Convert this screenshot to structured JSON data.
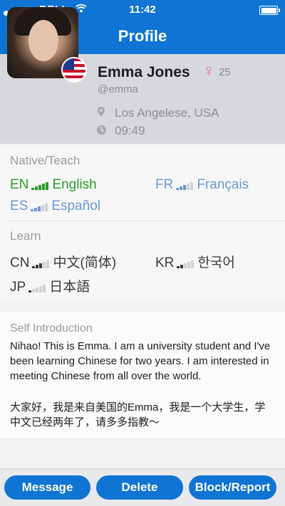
{
  "status_bar": {
    "carrier": "BELL",
    "time": "11:42"
  },
  "header": {
    "title": "Profile"
  },
  "profile": {
    "name": "Emma Jones",
    "gender_symbol": "♀",
    "age": "25",
    "handle": "@emma",
    "location": "Los Angelese, USA",
    "local_time": "09:49",
    "flag": "us-flag-icon"
  },
  "native_teach": {
    "title": "Native/Teach",
    "items": [
      {
        "code": "EN",
        "name": "English",
        "level": 5,
        "color": "#2a9d2a"
      },
      {
        "code": "FR",
        "name": "Français",
        "level": 3,
        "color": "#6a9ad0"
      },
      {
        "code": "ES",
        "name": "Español",
        "level": 3,
        "color": "#6a9ad0"
      }
    ]
  },
  "learn": {
    "title": "Learn",
    "items": [
      {
        "code": "CN",
        "name": "中文(简体)",
        "level": 3,
        "color": "#3a3a3e"
      },
      {
        "code": "KR",
        "name": "한국어",
        "level": 2,
        "color": "#3a3a3e"
      },
      {
        "code": "JP",
        "name": "日本語",
        "level": 1,
        "color": "#3a3a3e"
      }
    ]
  },
  "self_intro": {
    "title": "Self Introduction",
    "english": "Nihao! This is Emma. I am a university student and I've been learning Chinese for two years. I am interested in meeting Chinese from all over the world.",
    "chinese": "大家好，我是来自美国的Emma，我是一个大学生，学中文已经两年了，请多多指教～"
  },
  "actions": {
    "message": "Message",
    "delete": "Delete",
    "block": "Block/Report"
  },
  "colors": {
    "brand": "#0f74d3"
  }
}
